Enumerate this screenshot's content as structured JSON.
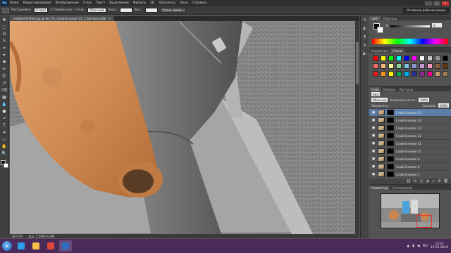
{
  "app": {
    "logo": "Ps"
  },
  "menu": [
    "Файл",
    "Редактирование",
    "Изображение",
    "Слои",
    "Текст",
    "Выделение",
    "Фильтр",
    "3D",
    "Просмотр",
    "Окно",
    "Справка"
  ],
  "window_buttons": {
    "minimize": "–",
    "maximize": "□",
    "close": "✕"
  },
  "options": {
    "feather_label": "Растушевка:",
    "feather_value": "0 пикс",
    "antialias_label": "Сглаживание",
    "style_label": "Стиль:",
    "style_value": "Обычный",
    "width_label": "Шир.:",
    "height_label": "Выс.:",
    "refine_button": "Уточн. край...",
    "workspace": "Основная рабочая среда"
  },
  "tools": [
    "move-tool",
    "marquee-tool",
    "lasso-tool",
    "quick-select-tool",
    "crop-tool",
    "eyedropper-tool",
    "healing-tool",
    "brush-tool",
    "clone-tool",
    "history-brush-tool",
    "eraser-tool",
    "gradient-tool",
    "blur-tool",
    "dodge-tool",
    "pen-tool",
    "type-tool",
    "path-select-tool",
    "shape-tool",
    "hand-tool",
    "zoom-tool"
  ],
  "tool_glyphs": [
    "✥",
    "⬚",
    "ʘ",
    "✎",
    "⌗",
    "✒",
    "✚",
    "✏",
    "⎘",
    "↺",
    "⌫",
    "▦",
    "💧",
    "●",
    "✑",
    "T",
    "➤",
    "▭",
    "✋",
    "🔍"
  ],
  "document": {
    "tab_title": "2ebb0a45d9b9.jpg @ 66,7% (Слой 8 копия 15, Слой-маска/8)",
    "close": "×"
  },
  "status": {
    "zoom": "66,67%",
    "doc_size": "Док: 2,59М/70,6М"
  },
  "iconstrip": [
    "history-icon",
    "adjust-icon",
    "paragraph-icon",
    "character-icon",
    "actions-icon"
  ],
  "iconstrip_glyphs": [
    "⟲",
    "◐",
    "¶",
    "A",
    "▶"
  ],
  "color_panel": {
    "tabs": [
      "Цвет",
      "Образцы"
    ],
    "slider_label": "K",
    "slider_value": "0"
  },
  "swatch_panel": {
    "tabs": [
      "Коррекция",
      "Стили"
    ],
    "colors": [
      "#ff0000",
      "#ffff00",
      "#00ff00",
      "#00ffff",
      "#0000ff",
      "#ff00ff",
      "#ffffff",
      "#c8c8c8",
      "#969696",
      "#000000",
      "#f26b6b",
      "#f7b977",
      "#fff799",
      "#8ed29a",
      "#7cc6e8",
      "#8f97cf",
      "#c39bd3",
      "#f49ac1",
      "#8c6239",
      "#603913",
      "#ed1c24",
      "#f7941d",
      "#fff200",
      "#00a651",
      "#00aeef",
      "#2e3192",
      "#92278f",
      "#ec008c",
      "#c69c6d",
      "#a67c52"
    ]
  },
  "layers_panel": {
    "tabs": [
      "Слои",
      "Каналы",
      "Контуры"
    ],
    "kind_label": "Вид",
    "blend_mode": "Обычные",
    "opacity_label": "Непрозрачность:",
    "opacity_value": "100%",
    "lock_label": "Закрепить:",
    "fill_label": "Заливка:",
    "fill_value": "100%",
    "layers": [
      {
        "name": "Слой 8 копия 15",
        "selected": true
      },
      {
        "name": "Слой 8 копия 14",
        "selected": false
      },
      {
        "name": "Слой 8 копия 13",
        "selected": false
      },
      {
        "name": "Слой 8 копия 12",
        "selected": false
      },
      {
        "name": "Слой 8 копия 11",
        "selected": false
      },
      {
        "name": "Слой 8 копия 10",
        "selected": false
      },
      {
        "name": "Слой 8 копия 9",
        "selected": false
      },
      {
        "name": "Слой 8 копия 8",
        "selected": false
      },
      {
        "name": "Слой 8 копия 7",
        "selected": false
      }
    ],
    "footer_icons": [
      "link-icon",
      "fx-icon",
      "mask-icon",
      "adjustment-icon",
      "folder-icon",
      "new-layer-icon",
      "trash-icon"
    ],
    "footer_glyphs": [
      "⛓",
      "fx",
      "◫",
      "◑",
      "▭",
      "⊞",
      "🗑"
    ]
  },
  "navigator_panel": {
    "tabs": [
      "Навигатор",
      "Гистограмма"
    ]
  },
  "taskbar": {
    "apps": [
      {
        "name": "ie-app",
        "color": "#2aa0e8"
      },
      {
        "name": "explorer-app",
        "color": "#f2c04a"
      },
      {
        "name": "media-app",
        "color": "#e04a3a"
      },
      {
        "name": "photoshop-app",
        "color": "#2c6fc0"
      }
    ],
    "time": "13:57",
    "date": "15.01.2016",
    "lang": "RU"
  }
}
